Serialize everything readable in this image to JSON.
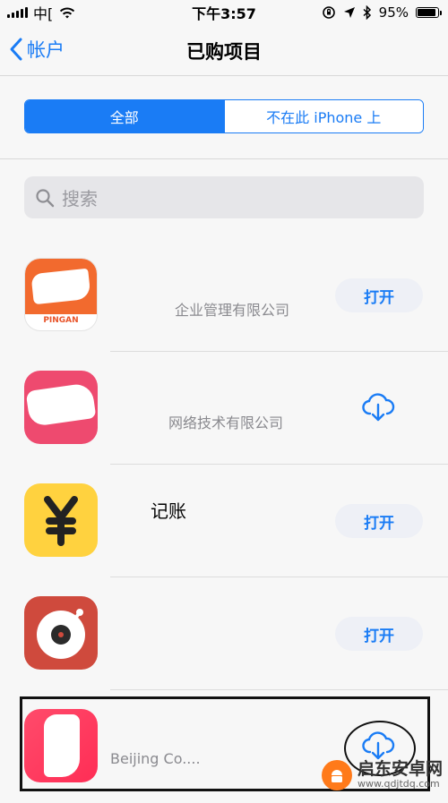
{
  "status_bar": {
    "carrier": "中[ ",
    "time": "下午3:57",
    "battery": "95%",
    "battery_level": 0.95
  },
  "nav": {
    "back_label": "帐户",
    "title": "已购项目"
  },
  "segments": [
    {
      "label": "全部",
      "active": true
    },
    {
      "label": "不在此 iPhone 上",
      "active": false
    }
  ],
  "search": {
    "placeholder": "搜索"
  },
  "apps": [
    {
      "name": "",
      "subtitle": "企业管理有限公司",
      "action": "打开",
      "icon_label": "PINGAN"
    },
    {
      "name": "",
      "subtitle": "网络技术有限公司",
      "action": "download-cloud-icon"
    },
    {
      "name": "记账",
      "subtitle": "",
      "action": "打开"
    },
    {
      "name": "",
      "subtitle": "",
      "action": "打开"
    },
    {
      "name": "",
      "subtitle": "Beijing                Co....",
      "action": "download-cloud-icon"
    }
  ],
  "watermark": {
    "title": "启东安卓网",
    "url": "www.qdjtdq.com"
  },
  "colors": {
    "accent": "#1a7cf5",
    "pingan": "#f26a2e",
    "pink": "#ee4a6f",
    "yellow": "#ffd23f",
    "red": "#cf4a3d"
  }
}
